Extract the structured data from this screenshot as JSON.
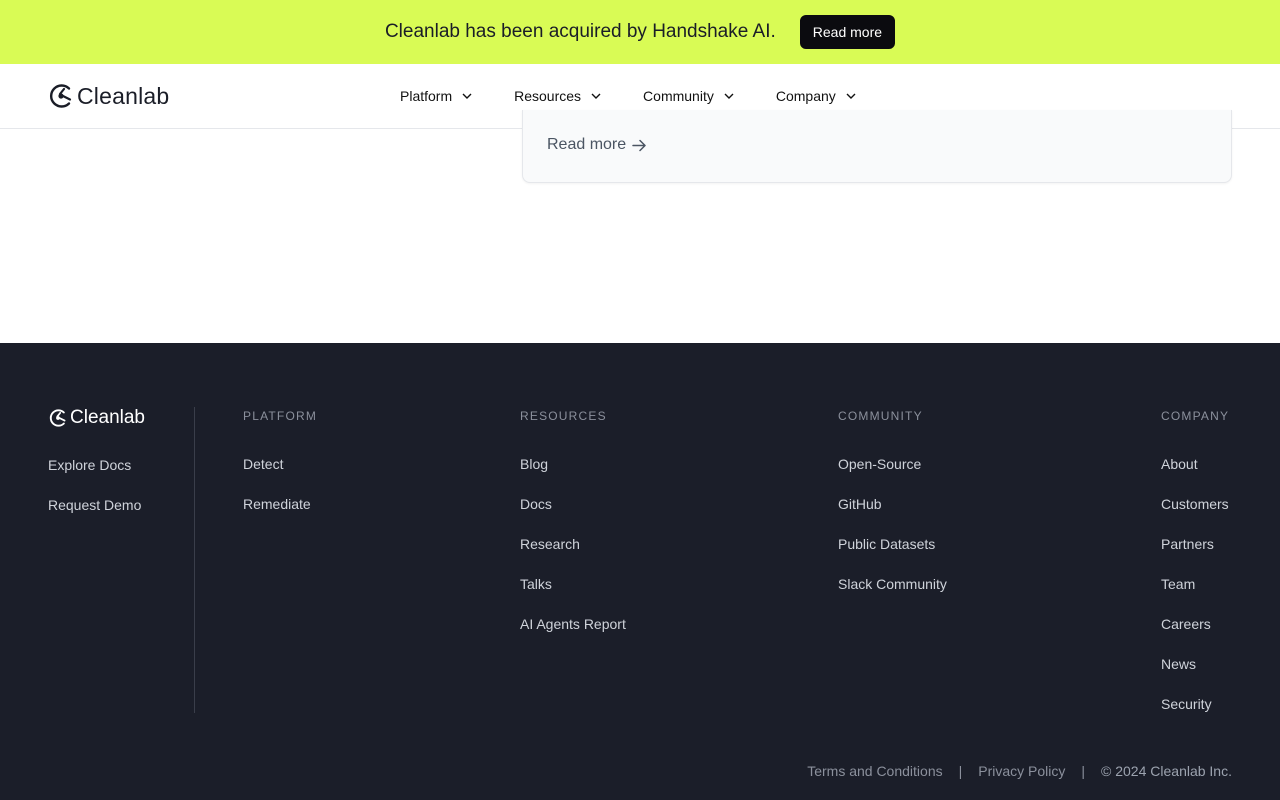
{
  "banner": {
    "text": "Cleanlab has been acquired by Handshake AI.",
    "button_label": "Read more",
    "bg_color": "#d9fb55"
  },
  "nav": {
    "logo_text": "Cleanlab",
    "items": [
      {
        "label": "Platform"
      },
      {
        "label": "Resources"
      },
      {
        "label": "Community"
      },
      {
        "label": "Company"
      }
    ]
  },
  "card": {
    "link_label": "Read more"
  },
  "footer": {
    "logo_text": "Cleanlab",
    "brand_links": [
      "Explore Docs",
      "Request Demo"
    ],
    "columns": [
      {
        "heading": "PLATFORM",
        "links": [
          "Detect",
          "Remediate"
        ]
      },
      {
        "heading": "RESOURCES",
        "links": [
          "Blog",
          "Docs",
          "Research",
          "Talks",
          "AI Agents Report"
        ]
      },
      {
        "heading": "COMMUNITY",
        "links": [
          "Open-Source",
          "GitHub",
          "Public Datasets",
          "Slack Community"
        ]
      },
      {
        "heading": "COMPANY",
        "links": [
          "About",
          "Customers",
          "Partners",
          "Team",
          "Careers",
          "News",
          "Security"
        ]
      }
    ],
    "legal": {
      "terms": "Terms and Conditions",
      "separator": "|",
      "privacy": "Privacy Policy",
      "copyright": "© 2024 Cleanlab Inc."
    },
    "bg_color": "#1b1e29"
  }
}
